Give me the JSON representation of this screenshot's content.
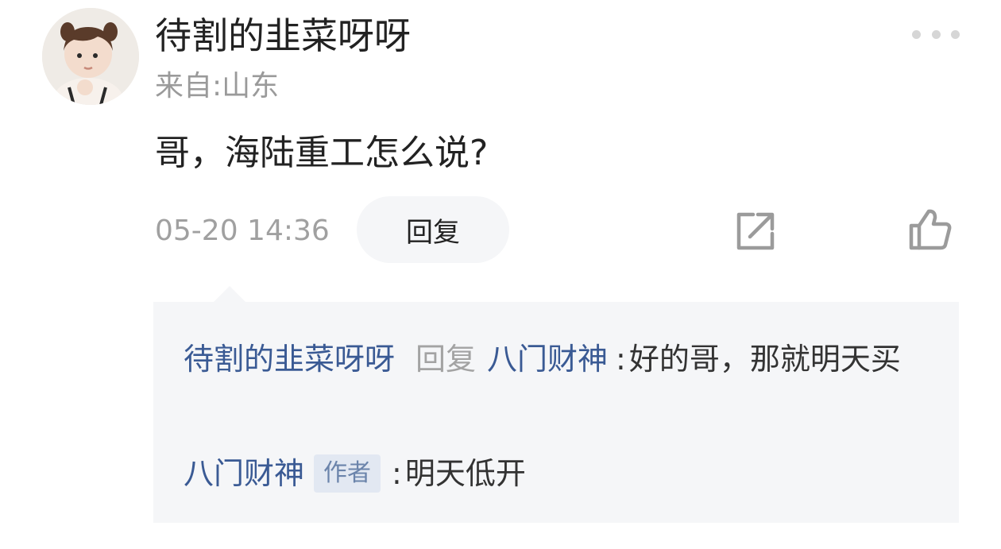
{
  "comment": {
    "username": "待割的韭菜呀呀",
    "location": "来自:山东",
    "text": "哥，海陆重工怎么说?",
    "timestamp": "05-20 14:36",
    "reply_button": "回复",
    "more_icon": "more-dots-icon",
    "share_icon": "share-icon",
    "like_icon": "thumbs-up-icon"
  },
  "replies": [
    {
      "from": "待割的韭菜呀呀",
      "reply_word": "回复",
      "to": "八门财神",
      "separator": ":",
      "text": "好的哥，那就明天买"
    },
    {
      "from": "八门财神",
      "badge": "作者",
      "separator": ":",
      "text": "明天低开"
    }
  ],
  "colors": {
    "link": "#3a5a94",
    "muted": "#a0a0a0",
    "reply_background": "#f5f6f8",
    "badge_background": "#e2e8f2"
  }
}
